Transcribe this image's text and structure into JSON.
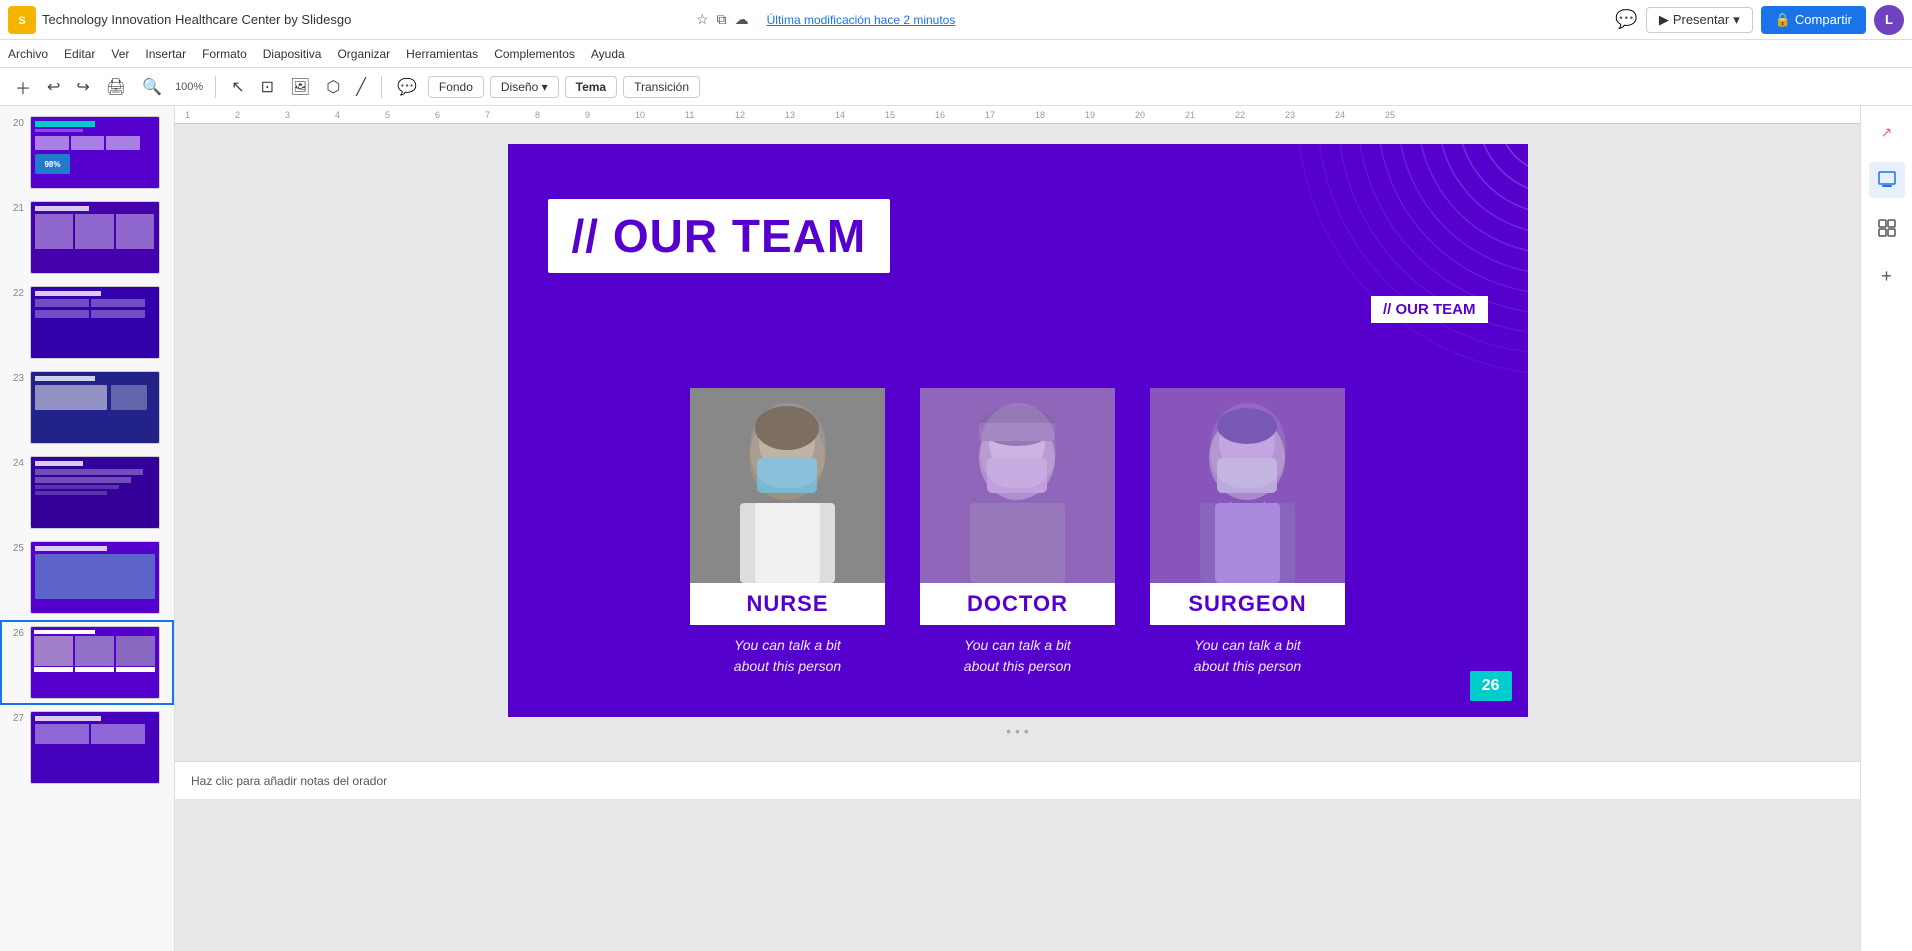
{
  "app": {
    "icon": "S",
    "title": "Technology Innovation Healthcare Center by Slidesgo",
    "last_modified": "Última modificación hace 2 minutos"
  },
  "menubar": {
    "items": [
      "Archivo",
      "Editar",
      "Ver",
      "Insertar",
      "Formato",
      "Diapositiva",
      "Organizar",
      "Herramientas",
      "Complementos",
      "Ayuda"
    ]
  },
  "toolbar": {
    "fondo_label": "Fondo",
    "diseno_label": "Diseño",
    "tema_label": "Tema",
    "transicion_label": "Transición"
  },
  "header": {
    "presentar_label": "Presentar",
    "compartir_label": "Compartir",
    "avatar_text": "L"
  },
  "slide": {
    "title_prefix": "// OUR TEAM",
    "top_right_label": "// OUR TEAM",
    "slide_number": "26",
    "team_members": [
      {
        "role": "NURSE",
        "description": "You can talk a bit\nabout this person",
        "photo_type": "nurse"
      },
      {
        "role": "DOCTOR",
        "description": "You can talk a bit\nabout this person",
        "photo_type": "doctor"
      },
      {
        "role": "SURGEON",
        "description": "You can talk a bit\nabout this person",
        "photo_type": "surgeon"
      }
    ]
  },
  "sidebar": {
    "slides": [
      {
        "num": "20",
        "class": "thumb-content-20"
      },
      {
        "num": "21",
        "class": "thumb-content-21"
      },
      {
        "num": "22",
        "class": "thumb-content-22"
      },
      {
        "num": "23",
        "class": "thumb-content-23"
      },
      {
        "num": "24",
        "class": "thumb-content-24"
      },
      {
        "num": "25",
        "class": "thumb-content-25"
      },
      {
        "num": "26",
        "class": "thumb-content-26",
        "active": true
      },
      {
        "num": "27",
        "class": "thumb-content-27"
      }
    ]
  },
  "bottombar": {
    "notes_placeholder": "Haz clic para añadir notas del orador"
  },
  "icons": {
    "star": "☆",
    "copy": "⧉",
    "cloud": "☁",
    "comment": "💬",
    "lock": "🔒",
    "arrow_up": "↗",
    "undo": "↩",
    "redo": "↪",
    "print": "🖨",
    "zoom_in": "+",
    "zoom_out": "−",
    "cursor": "↖",
    "text": "T",
    "plus": "+",
    "minus": "−",
    "grid": "⊞",
    "lines": "☰"
  }
}
